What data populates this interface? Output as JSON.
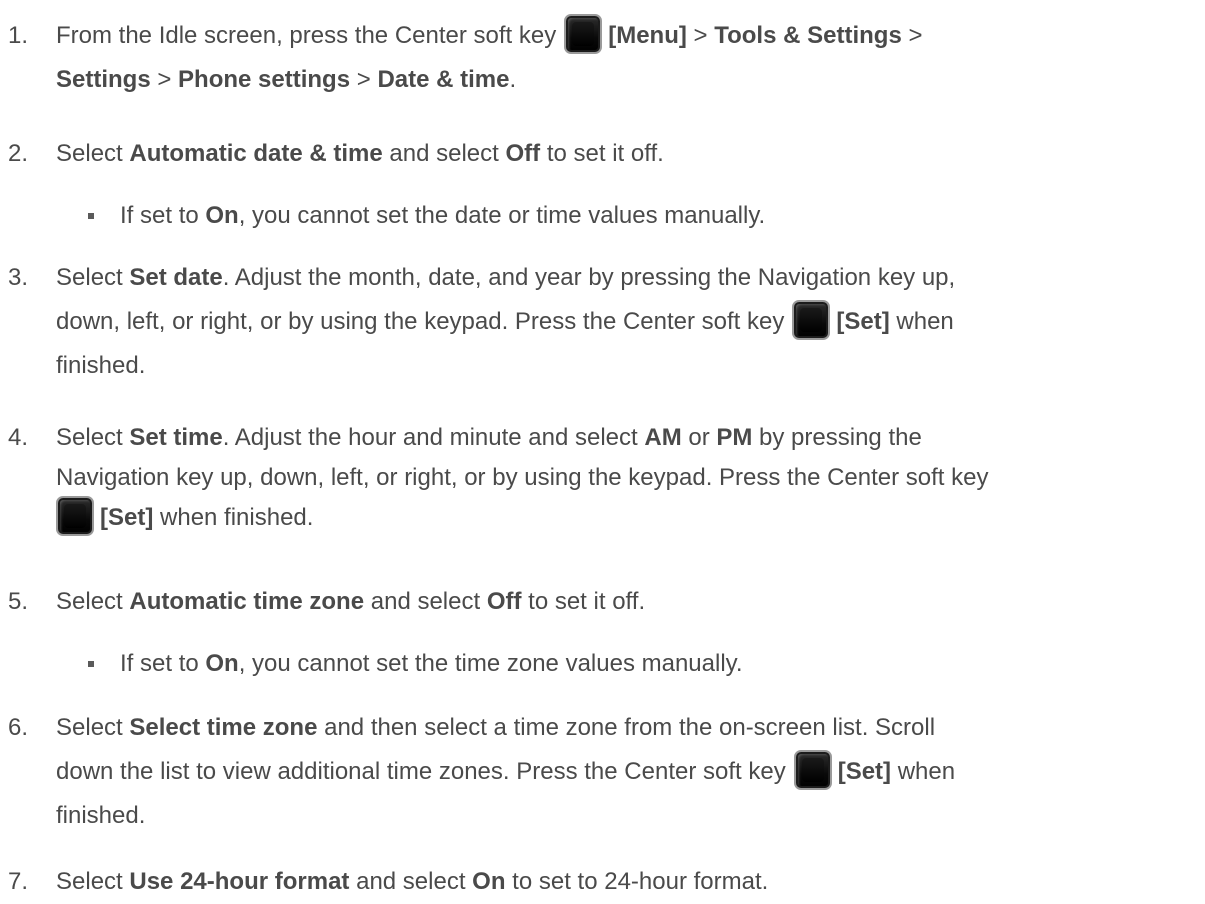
{
  "steps": [
    {
      "num": "1.",
      "line1_a": "From the Idle screen, press the Center soft key",
      "key_label": "[Menu]",
      "sep": " > ",
      "b1": "Tools & Settings",
      "b2": "Settings",
      "b3": "Phone settings",
      "b4": "Date & time",
      "end": "."
    },
    {
      "num": "2.",
      "a": "Select ",
      "b1": "Automatic date & time",
      "m": " and select ",
      "b2": "Off",
      "e": " to set it off.",
      "sub": {
        "a": "If set to ",
        "b": "On",
        "e": ", you cannot set the date or time values manually."
      }
    },
    {
      "num": "3.",
      "a": "Select ",
      "b1": "Set date",
      "m": ". Adjust the month, date, and year by pressing the Navigation key up,",
      "line2": "down, left, or right, or by using the keypad. Press the Center soft key",
      "key_label": "[Set]",
      "after_key": " when",
      "line3": "finished."
    },
    {
      "num": "4.",
      "a": "Select ",
      "b1": "Set time",
      "m1": ". Adjust the hour and minute and select ",
      "b2": "AM",
      "m2": " or ",
      "b3": "PM",
      "m3": " by pressing the",
      "line2": "Navigation key up, down, left, or right, or by using the keypad. Press the Center soft key",
      "key_label": "[Set]",
      "after_key": " when finished."
    },
    {
      "num": "5.",
      "a": "Select ",
      "b1": "Automatic time zone",
      "m": " and select ",
      "b2": "Off",
      "e": " to set it off.",
      "sub": {
        "a": "If set to ",
        "b": "On",
        "e": ", you cannot set the time zone values manually."
      }
    },
    {
      "num": "6.",
      "a": "Select ",
      "b1": "Select time zone",
      "m": " and then select a time zone from the on-screen list. Scroll",
      "line2": "down the list to view additional time zones. Press the Center soft key",
      "key_label": "[Set]",
      "after_key": " when",
      "line3": "finished."
    },
    {
      "num": "7.",
      "a": "Select ",
      "b1": "Use 24-hour format",
      "m": " and select ",
      "b2": "On",
      "e": " to set to 24-hour format."
    }
  ]
}
